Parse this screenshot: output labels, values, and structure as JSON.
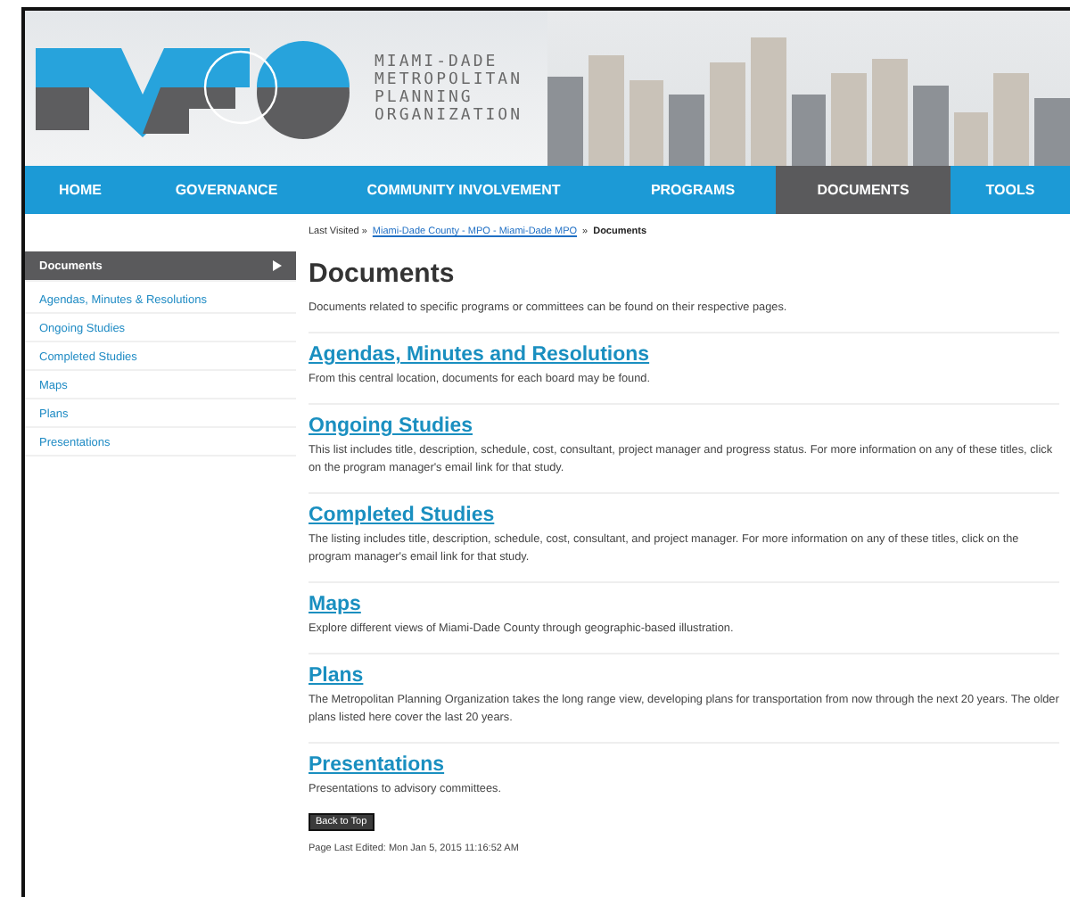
{
  "header": {
    "org_name_lines": [
      "MIAMI-DADE",
      "METROPOLITAN",
      "PLANNING",
      "ORGANIZATION"
    ]
  },
  "nav": [
    {
      "label": "HOME",
      "selected": false
    },
    {
      "label": "GOVERNANCE",
      "selected": false
    },
    {
      "label": "COMMUNITY INVOLVEMENT",
      "selected": false
    },
    {
      "label": "PROGRAMS",
      "selected": false
    },
    {
      "label": "DOCUMENTS",
      "selected": true
    },
    {
      "label": "TOOLS",
      "selected": false
    }
  ],
  "breadcrumb": {
    "prefix": "Last Visited »",
    "link": "Miami-Dade County - MPO - Miami-Dade MPO",
    "separator": "»",
    "current": "Documents"
  },
  "sidebar": {
    "items": [
      {
        "label": "Documents",
        "selected": true
      },
      {
        "label": "Agendas, Minutes & Resolutions",
        "selected": false
      },
      {
        "label": "Ongoing Studies",
        "selected": false
      },
      {
        "label": "Completed Studies",
        "selected": false
      },
      {
        "label": "Maps",
        "selected": false
      },
      {
        "label": "Plans",
        "selected": false
      },
      {
        "label": "Presentations",
        "selected": false
      }
    ]
  },
  "main": {
    "title": "Documents",
    "intro": "Documents related to specific programs or committees can be found on their respective pages.",
    "sections": [
      {
        "heading": "Agendas, Minutes and Resolutions",
        "text": "From this central location, documents for each board may be found."
      },
      {
        "heading": "Ongoing Studies",
        "text": "This list includes title, description, schedule, cost, consultant, project manager and progress status. For more information on any of these titles, click on the program manager's email link for that study."
      },
      {
        "heading": "Completed Studies",
        "text": "The listing includes title, description, schedule, cost, consultant, and project manager. For more information on any of these titles, click on the program manager's email link for that study."
      },
      {
        "heading": "Maps",
        "text": "Explore different views of Miami-Dade County through geographic-based illustration."
      },
      {
        "heading": "Plans",
        "text": "The Metropolitan Planning Organization takes the long range view, developing plans for transportation from now through the next 20 years. The older plans listed here cover the last 20 years."
      },
      {
        "heading": "Presentations",
        "text": "Presentations to advisory committees."
      }
    ],
    "back_to_top": "Back to Top",
    "last_edited": "Page Last Edited: Mon Jan 5, 2015 11:16:52 AM"
  }
}
